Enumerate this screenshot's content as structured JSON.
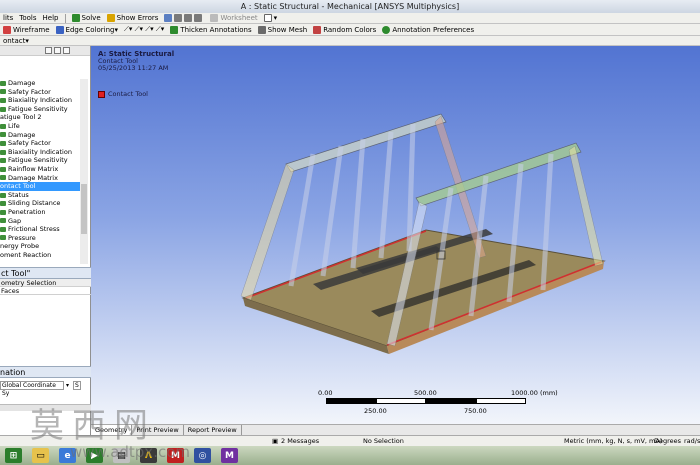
{
  "window": {
    "title": "A : Static Structural - Mechanical [ANSYS Multiphysics]"
  },
  "menubar": {
    "items": [
      "lits",
      "Tools",
      "Help"
    ]
  },
  "toolbar1": {
    "solve": "Solve",
    "show_errors": "Show Errors",
    "worksheet": "Worksheet"
  },
  "toolbar2": {
    "wireframe": "Wireframe",
    "edge_coloring": "Edge Coloring",
    "thicken": "Thicken Annotations",
    "show_mesh": "Show Mesh",
    "random_colors": "Random Colors",
    "annotation_prefs": "Annotation Preferences"
  },
  "toolbar3": {
    "contact": "ontact"
  },
  "tree": {
    "items": [
      "Damage",
      "Safety Factor",
      "Biaxiality Indication",
      "Fatigue Sensitivity",
      "atigue Tool 2",
      "Life",
      "Damage",
      "Safety Factor",
      "Biaxiality Indication",
      "Fatigue Sensitivity",
      "Rainflow Matrix",
      "Damage Matrix",
      "ontact Tool",
      "Status",
      "Sliding Distance",
      "Penetration",
      "Gap",
      "Frictional Stress",
      "Pressure",
      "nergy Probe",
      "oment Reaction"
    ],
    "selected_index": 12
  },
  "details": {
    "title": "ct Tool\"",
    "row1": "ometry Selection",
    "row2": "Faces"
  },
  "animation": {
    "title": "nation",
    "coord_system": "Global Coordinate Sy",
    "s_label": "S"
  },
  "viewport": {
    "header_title": "A: Static Structural",
    "header_sub": "Contact Tool",
    "header_date": "05/25/2013 11:27 AM",
    "legend_label": "Contact Tool",
    "legend_color": "#e02020"
  },
  "scale": {
    "t0": "0.00",
    "t500": "500.00",
    "t1000": "1000.00 (mm)",
    "b250": "250.00",
    "b750": "750.00"
  },
  "tabs": {
    "geometry": "Geometry",
    "print_preview": "Print Preview",
    "report_preview": "Report Preview"
  },
  "status": {
    "messages": "2 Messages",
    "selection": "No Selection",
    "units": "Metric (mm, kg, N, s, mV, mA)",
    "angle": "Degrees",
    "rad": "rad/s"
  },
  "watermark": {
    "main": "莫西网",
    "url": "www.adtpx.com"
  }
}
